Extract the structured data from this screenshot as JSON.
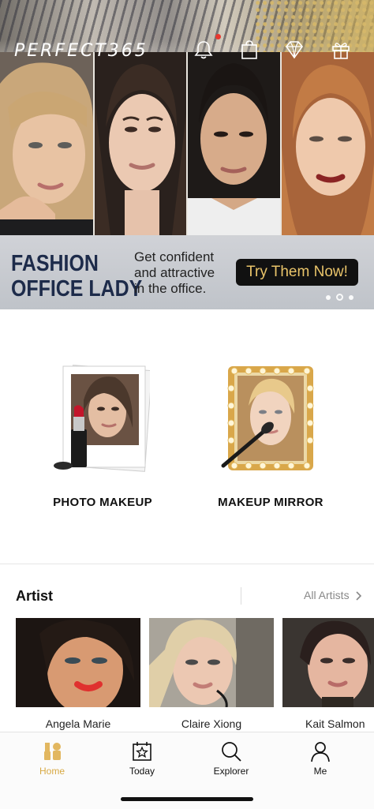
{
  "banner": {
    "logo": "PERFECT365",
    "promo_title_line1": "FASHION",
    "promo_title_line2": "OFFICE LADY",
    "promo_sub_line1": "Get confident",
    "promo_sub_line2": "and attractive",
    "promo_sub_line3": "in the office.",
    "cta_label": "Try Them Now!",
    "carousel_pages": 3,
    "carousel_active": 2
  },
  "header_icons": [
    "bell-icon",
    "shopping-bag-icon",
    "diamond-icon",
    "gift-icon"
  ],
  "features": {
    "photo_makeup": "PHOTO MAKEUP",
    "makeup_mirror": "MAKEUP MIRROR"
  },
  "artist_section": {
    "title": "Artist",
    "all_label": "All Artists",
    "artists": [
      {
        "name": "Angela Marie"
      },
      {
        "name": "Claire Xiong"
      },
      {
        "name": "Kait Salmon"
      }
    ]
  },
  "tabs": [
    {
      "label": "Home",
      "icon": "makeup-brush-icon",
      "active": true
    },
    {
      "label": "Today",
      "icon": "calendar-star-icon",
      "active": false
    },
    {
      "label": "Explorer",
      "icon": "search-icon",
      "active": false
    },
    {
      "label": "Me",
      "icon": "person-icon",
      "active": false
    }
  ],
  "colors": {
    "accent_gold": "#d8a943",
    "cta_text": "#e9c46a",
    "promo_title": "#1d2b4a",
    "notification_dot": "#e8382f"
  }
}
